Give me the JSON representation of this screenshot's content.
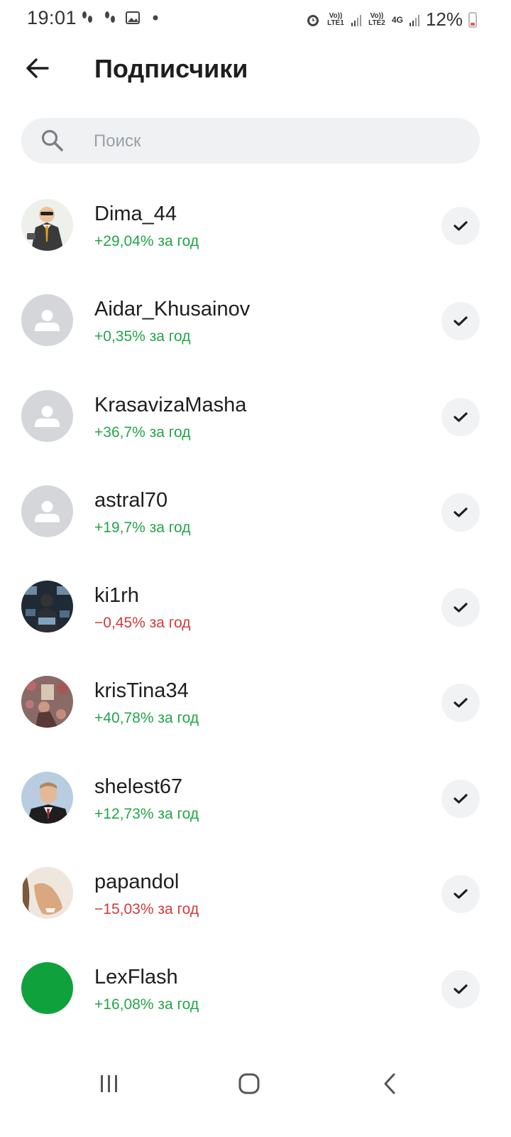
{
  "status_bar": {
    "time": "19:01",
    "sim1_label": "Vo)) LTE1",
    "sim2_label": "Vo)) LTE2",
    "network_type": "4G",
    "battery": "12%"
  },
  "header": {
    "title": "Подписчики"
  },
  "search": {
    "placeholder": "Поиск"
  },
  "subscribers": [
    {
      "name": "Dima_44",
      "stat": "+29,04% за год",
      "trend": "pos",
      "avatar": "cartoon-avatar"
    },
    {
      "name": "Aidar_Khusainov",
      "stat": "+0,35% за год",
      "trend": "pos",
      "avatar": "default-avatar"
    },
    {
      "name": "KrasavizaMasha",
      "stat": "+36,7% за год",
      "trend": "pos",
      "avatar": "default-avatar"
    },
    {
      "name": "astral70",
      "stat": "+19,7% за год",
      "trend": "pos",
      "avatar": "default-avatar"
    },
    {
      "name": "ki1rh",
      "stat": "−0,45% за год",
      "trend": "neg",
      "avatar": "photo-avatar"
    },
    {
      "name": "krisTina34",
      "stat": "+40,78% за год",
      "trend": "pos",
      "avatar": "photo-avatar"
    },
    {
      "name": "shelest67",
      "stat": "+12,73% за год",
      "trend": "pos",
      "avatar": "photo-avatar"
    },
    {
      "name": "papandol",
      "stat": "−15,03% за год",
      "trend": "neg",
      "avatar": "photo-avatar"
    },
    {
      "name": "LexFlash",
      "stat": "+16,08% за год",
      "trend": "pos",
      "avatar": "green-avatar"
    }
  ],
  "colors": {
    "positive": "#23a547",
    "negative": "#d33a3a",
    "search_bg": "#eff1f3",
    "default_avatar": "#d4d6da",
    "lexflash_avatar": "#0fa23c"
  },
  "icons": {
    "back": "arrow-left-icon",
    "search": "search-icon",
    "follow": "checkmark-icon",
    "nav_recent": "recent-apps-icon",
    "nav_home": "home-icon",
    "nav_back": "chevron-left-icon"
  }
}
